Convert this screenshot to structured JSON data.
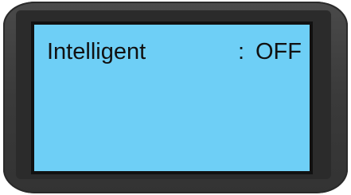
{
  "lcd": {
    "setting_label": "Intelligent",
    "separator": ":",
    "setting_value": "OFF"
  },
  "colors": {
    "lcd_background": "#6ecff6",
    "bezel": "#3a3a3a",
    "text": "#111111"
  }
}
